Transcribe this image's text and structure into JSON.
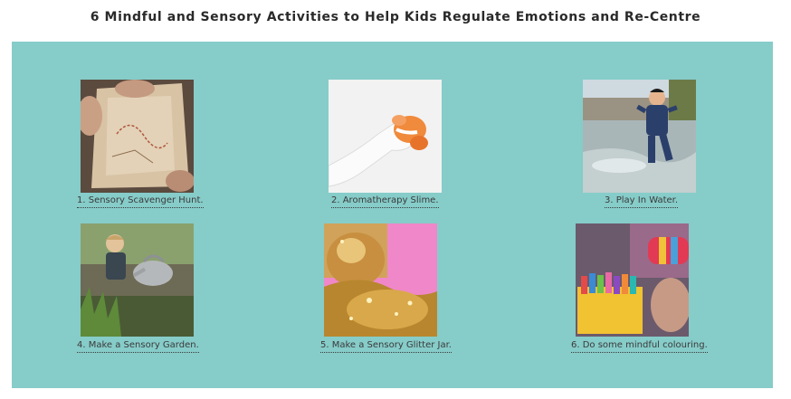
{
  "page": {
    "title": "6 Mindful and Sensory Activities to Help Kids Regulate Emotions and Re-Centre"
  },
  "colors": {
    "panel_background": "#86ccc9",
    "caption_text": "#3a3a3a",
    "title_text": "#2a2a2a"
  },
  "activities": [
    {
      "label": "1. Sensory Scavenger Hunt.",
      "image": "treasure-map-photo"
    },
    {
      "label": "2. Aromatherapy Slime.",
      "image": "slime-hand-photo"
    },
    {
      "label": "3. Play In Water.",
      "image": "child-running-water-photo"
    },
    {
      "label": "4. Make a Sensory Garden.",
      "image": "child-watering-can-photo"
    },
    {
      "label": "5. Make a Sensory Glitter Jar.",
      "image": "glitter-jar-photo"
    },
    {
      "label": "6. Do some mindful colouring.",
      "image": "crayons-photo"
    }
  ]
}
